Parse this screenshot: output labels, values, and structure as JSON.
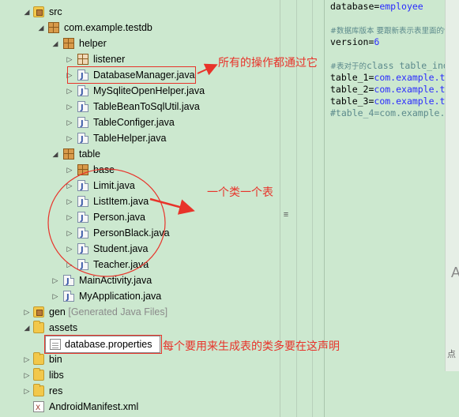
{
  "tree": {
    "src": "src",
    "pkg_root": "com.example.testdb",
    "helper": "helper",
    "listener": "listener",
    "database_manager": "DatabaseManager.java",
    "my_sqlite_open_helper": "MySqliteOpenHelper.java",
    "table_bean_to_sql_util": "TableBeanToSqlUtil.java",
    "table_configer": "TableConfiger.java",
    "table_helper": "TableHelper.java",
    "table": "table",
    "base": "base",
    "limit": "Limit.java",
    "list_item": "ListItem.java",
    "person": "Person.java",
    "person_black": "PersonBlack.java",
    "student": "Student.java",
    "teacher": "Teacher.java",
    "main_activity": "MainActivity.java",
    "my_application": "MyApplication.java",
    "gen": "gen",
    "gen_suffix": "[Generated Java Files]",
    "assets": "assets",
    "database_properties": "database.properties",
    "bin": "bin",
    "libs": "libs",
    "res": "res",
    "android_manifest": "AndroidManifest.xml"
  },
  "editor": {
    "line1_key": "database",
    "line1_val": "employee",
    "comment1": "#数据库版本 要跟新表示表里面的ve",
    "line2_key": "version",
    "line2_val": "6",
    "comment2_prefix": "#表对于的",
    "comment2_rest": "class table_ind",
    "table1_key": "table_1",
    "table1_val": "com.example.t",
    "table2_key": "table_2",
    "table2_val": "com.example.t",
    "table3_key": "table_3",
    "table3_val": "com.example.t",
    "table4_comment": "#table_4=com.example.",
    "equals": "="
  },
  "side": {
    "glyph_a": "A",
    "glyph_dian": "点"
  },
  "annotations": {
    "note_all_ops": "所有的操作都通过它",
    "note_one_class_one_table": "一个类一个表",
    "note_declare": "每个要用来生成表的类多要在这声明",
    "color": "#e8332a"
  }
}
